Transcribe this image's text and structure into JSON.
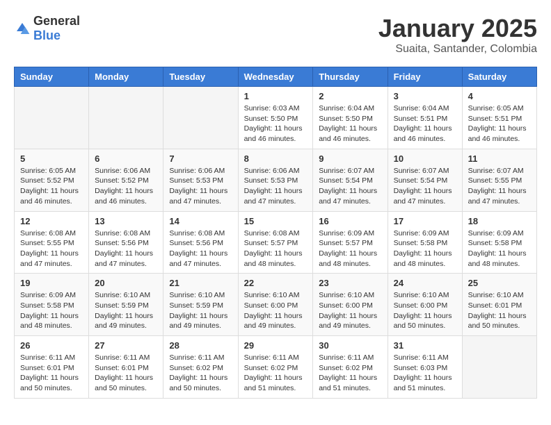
{
  "header": {
    "logo_general": "General",
    "logo_blue": "Blue",
    "month": "January 2025",
    "location": "Suaita, Santander, Colombia"
  },
  "days_of_week": [
    "Sunday",
    "Monday",
    "Tuesday",
    "Wednesday",
    "Thursday",
    "Friday",
    "Saturday"
  ],
  "weeks": [
    [
      {
        "day": "",
        "info": ""
      },
      {
        "day": "",
        "info": ""
      },
      {
        "day": "",
        "info": ""
      },
      {
        "day": "1",
        "info": "Sunrise: 6:03 AM\nSunset: 5:50 PM\nDaylight: 11 hours and 46 minutes."
      },
      {
        "day": "2",
        "info": "Sunrise: 6:04 AM\nSunset: 5:50 PM\nDaylight: 11 hours and 46 minutes."
      },
      {
        "day": "3",
        "info": "Sunrise: 6:04 AM\nSunset: 5:51 PM\nDaylight: 11 hours and 46 minutes."
      },
      {
        "day": "4",
        "info": "Sunrise: 6:05 AM\nSunset: 5:51 PM\nDaylight: 11 hours and 46 minutes."
      }
    ],
    [
      {
        "day": "5",
        "info": "Sunrise: 6:05 AM\nSunset: 5:52 PM\nDaylight: 11 hours and 46 minutes."
      },
      {
        "day": "6",
        "info": "Sunrise: 6:06 AM\nSunset: 5:52 PM\nDaylight: 11 hours and 46 minutes."
      },
      {
        "day": "7",
        "info": "Sunrise: 6:06 AM\nSunset: 5:53 PM\nDaylight: 11 hours and 47 minutes."
      },
      {
        "day": "8",
        "info": "Sunrise: 6:06 AM\nSunset: 5:53 PM\nDaylight: 11 hours and 47 minutes."
      },
      {
        "day": "9",
        "info": "Sunrise: 6:07 AM\nSunset: 5:54 PM\nDaylight: 11 hours and 47 minutes."
      },
      {
        "day": "10",
        "info": "Sunrise: 6:07 AM\nSunset: 5:54 PM\nDaylight: 11 hours and 47 minutes."
      },
      {
        "day": "11",
        "info": "Sunrise: 6:07 AM\nSunset: 5:55 PM\nDaylight: 11 hours and 47 minutes."
      }
    ],
    [
      {
        "day": "12",
        "info": "Sunrise: 6:08 AM\nSunset: 5:55 PM\nDaylight: 11 hours and 47 minutes."
      },
      {
        "day": "13",
        "info": "Sunrise: 6:08 AM\nSunset: 5:56 PM\nDaylight: 11 hours and 47 minutes."
      },
      {
        "day": "14",
        "info": "Sunrise: 6:08 AM\nSunset: 5:56 PM\nDaylight: 11 hours and 47 minutes."
      },
      {
        "day": "15",
        "info": "Sunrise: 6:08 AM\nSunset: 5:57 PM\nDaylight: 11 hours and 48 minutes."
      },
      {
        "day": "16",
        "info": "Sunrise: 6:09 AM\nSunset: 5:57 PM\nDaylight: 11 hours and 48 minutes."
      },
      {
        "day": "17",
        "info": "Sunrise: 6:09 AM\nSunset: 5:58 PM\nDaylight: 11 hours and 48 minutes."
      },
      {
        "day": "18",
        "info": "Sunrise: 6:09 AM\nSunset: 5:58 PM\nDaylight: 11 hours and 48 minutes."
      }
    ],
    [
      {
        "day": "19",
        "info": "Sunrise: 6:09 AM\nSunset: 5:58 PM\nDaylight: 11 hours and 48 minutes."
      },
      {
        "day": "20",
        "info": "Sunrise: 6:10 AM\nSunset: 5:59 PM\nDaylight: 11 hours and 49 minutes."
      },
      {
        "day": "21",
        "info": "Sunrise: 6:10 AM\nSunset: 5:59 PM\nDaylight: 11 hours and 49 minutes."
      },
      {
        "day": "22",
        "info": "Sunrise: 6:10 AM\nSunset: 6:00 PM\nDaylight: 11 hours and 49 minutes."
      },
      {
        "day": "23",
        "info": "Sunrise: 6:10 AM\nSunset: 6:00 PM\nDaylight: 11 hours and 49 minutes."
      },
      {
        "day": "24",
        "info": "Sunrise: 6:10 AM\nSunset: 6:00 PM\nDaylight: 11 hours and 50 minutes."
      },
      {
        "day": "25",
        "info": "Sunrise: 6:10 AM\nSunset: 6:01 PM\nDaylight: 11 hours and 50 minutes."
      }
    ],
    [
      {
        "day": "26",
        "info": "Sunrise: 6:11 AM\nSunset: 6:01 PM\nDaylight: 11 hours and 50 minutes."
      },
      {
        "day": "27",
        "info": "Sunrise: 6:11 AM\nSunset: 6:01 PM\nDaylight: 11 hours and 50 minutes."
      },
      {
        "day": "28",
        "info": "Sunrise: 6:11 AM\nSunset: 6:02 PM\nDaylight: 11 hours and 50 minutes."
      },
      {
        "day": "29",
        "info": "Sunrise: 6:11 AM\nSunset: 6:02 PM\nDaylight: 11 hours and 51 minutes."
      },
      {
        "day": "30",
        "info": "Sunrise: 6:11 AM\nSunset: 6:02 PM\nDaylight: 11 hours and 51 minutes."
      },
      {
        "day": "31",
        "info": "Sunrise: 6:11 AM\nSunset: 6:03 PM\nDaylight: 11 hours and 51 minutes."
      },
      {
        "day": "",
        "info": ""
      }
    ]
  ]
}
